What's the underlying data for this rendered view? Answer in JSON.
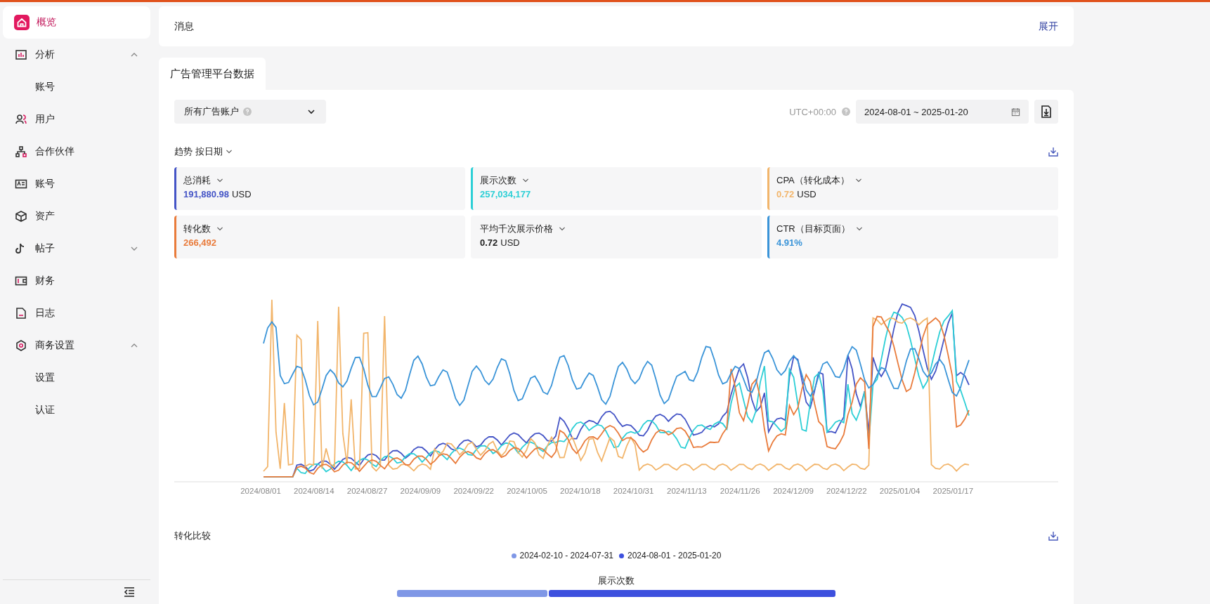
{
  "sidebar": {
    "items": [
      {
        "label": "概览",
        "selected": true
      },
      {
        "label": "分析",
        "selected": false,
        "expanded": true,
        "children": [
          {
            "label": "账号",
            "selected": false
          }
        ]
      },
      {
        "label": "用户",
        "selected": false
      },
      {
        "label": "合作伙伴",
        "selected": false
      },
      {
        "label": "账号",
        "selected": false
      },
      {
        "label": "资产",
        "selected": false
      },
      {
        "label": "帖子",
        "selected": false,
        "expanded": false
      },
      {
        "label": "财务",
        "selected": false
      },
      {
        "label": "日志",
        "selected": false
      },
      {
        "label": "商务设置",
        "selected": false,
        "expanded": true,
        "children": [
          {
            "label": "设置",
            "selected": false
          },
          {
            "label": "认证",
            "selected": false
          }
        ]
      }
    ]
  },
  "message_bar": {
    "title": "消息",
    "action": "展开"
  },
  "tabs": [
    {
      "label": "广告管理平台数据",
      "selected": true
    }
  ],
  "filters": {
    "account_select": "所有广告账户",
    "timezone": "UTC+00:00",
    "date_range": "2024-08-01 ~ 2025-01-20"
  },
  "trend": {
    "title": "趋势",
    "grouping": "按日期"
  },
  "metrics": [
    {
      "label": "总消耗",
      "value": "191,880.98",
      "unit": "USD",
      "color": "#4454c6"
    },
    {
      "label": "展示次数",
      "value": "257,034,177",
      "color": "#2ccfd6"
    },
    {
      "label": "CPA（转化成本）",
      "value": "0.72",
      "unit": "USD",
      "color": "#f2b56b"
    },
    {
      "label": "转化数",
      "value": "266,492",
      "color": "#e97b3b"
    },
    {
      "label": "平均千次展示价格",
      "value": "0.72",
      "unit": "USD"
    },
    {
      "label": "CTR（目标页面）",
      "value": "4.91%",
      "color": "#3a94d8"
    }
  ],
  "trend_chart": {
    "x_labels": [
      "2024/08/01",
      "2024/08/14",
      "2024/08/27",
      "2024/09/09",
      "2024/09/22",
      "2024/10/05",
      "2024/10/18",
      "2024/10/31",
      "2024/11/13",
      "2024/11/26",
      "2024/12/09",
      "2024/12/22",
      "2025/01/04",
      "2025/01/17"
    ]
  },
  "comparison": {
    "title": "转化比较",
    "legend": [
      {
        "label": "2024-02-10 - 2024-07-31",
        "color": "#7f97e6"
      },
      {
        "label": "2024-08-01 - 2025-01-20",
        "color": "#3d50de"
      }
    ],
    "metric_title": "展示次数"
  }
}
